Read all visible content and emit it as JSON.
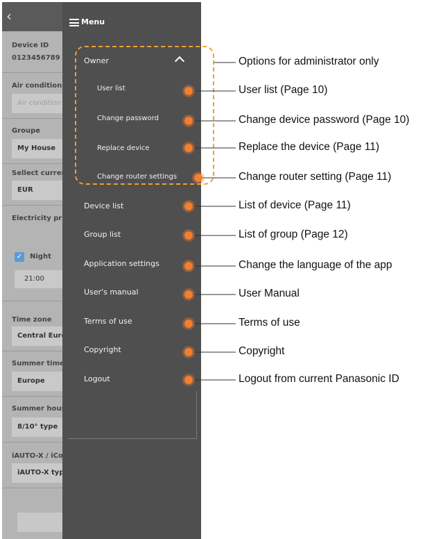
{
  "background_screen": {
    "back_label": "‹",
    "fields": [
      {
        "label": "Device ID",
        "value": "0123456789"
      },
      {
        "label": "Air condition",
        "value": "Air condition"
      },
      {
        "label": "Groupe",
        "value": "My House"
      },
      {
        "label": "Sellect curren",
        "value": "EUR"
      },
      {
        "label": "Electricity pri"
      },
      {
        "label": "Time zone",
        "value": "Central Euro"
      },
      {
        "label": "Summer time",
        "value": "Europe"
      },
      {
        "label": "Summer hous",
        "value": "8/10° type"
      },
      {
        "label": "iAUTO-X / iCo",
        "value": "iAUTO-X type"
      }
    ],
    "night_label": "Night",
    "time_value": "21:00",
    "time_chevron": "⌄",
    "check": "✓"
  },
  "menu": {
    "title": "Menu",
    "owner": {
      "label": "Owner",
      "sub_items": [
        "User list",
        "Change password",
        "Replace device",
        "Change router settings"
      ]
    },
    "items": [
      "Device list",
      "Group list",
      "Application settings",
      "User's manual",
      "Terms of use",
      "Copyright",
      "Logout"
    ]
  },
  "callouts": [
    "Options for administrator only",
    "User list (Page 10)",
    "Change device password (Page 10)",
    "Replace the device (Page 11)",
    "Change router setting (Page 11)",
    "List of device (Page 11)",
    "List of group (Page 12)",
    "Change the language of the app",
    "User Manual",
    "Terms of use",
    "Copyright",
    "Logout from current Panasonic ID"
  ],
  "colors": {
    "drawer_bg": "#4f4f4f",
    "accent_dot": "#f07f30",
    "dashed_border": "#f0a030"
  }
}
